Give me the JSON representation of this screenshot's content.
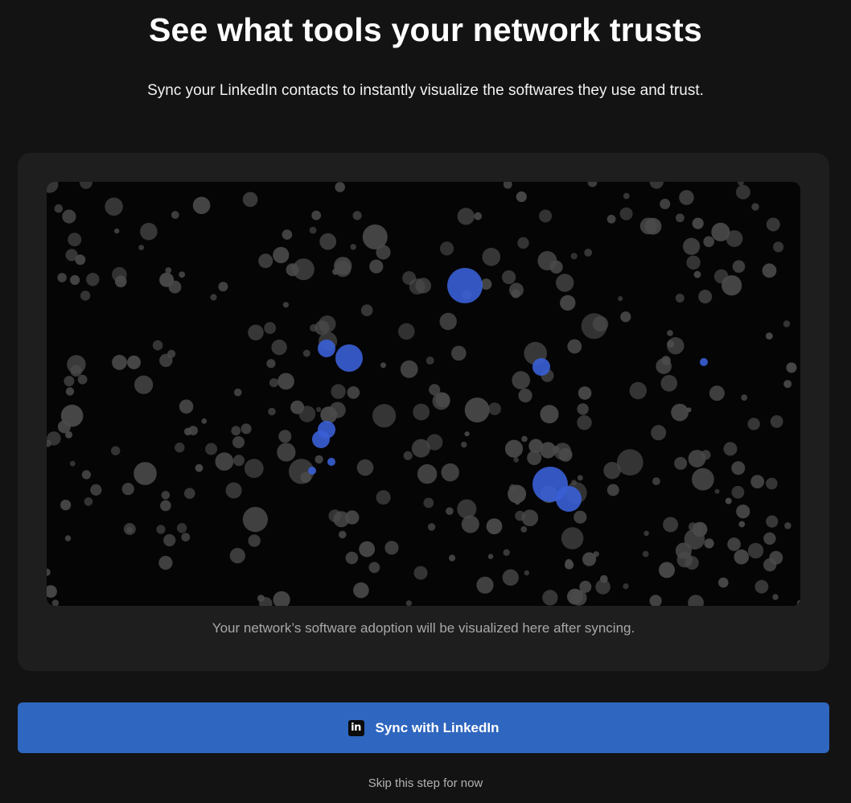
{
  "header": {
    "title": "See what tools your network trusts",
    "subtitle": "Sync your LinkedIn contacts to instantly visualize the softwares they use and trust."
  },
  "visualization": {
    "caption": "Your network’s software adoption will be visualized here after syncing.",
    "background_color": "#050505",
    "node_color": "#4a4a4a",
    "highlight_color": "#3a5fd6"
  },
  "actions": {
    "sync_label": "Sync with LinkedIn",
    "sync_icon": "linkedin-icon",
    "skip_label": "Skip this step for now"
  },
  "colors": {
    "page_bg": "#131313",
    "card_bg": "#1e1e1e",
    "accent": "#2f66bf"
  }
}
